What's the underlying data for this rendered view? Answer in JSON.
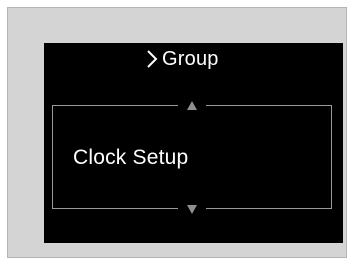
{
  "header": {
    "breadcrumb_text": "Group",
    "breadcrumb_icon": "chevron-right-icon"
  },
  "menu": {
    "current_item": "Clock Setup",
    "scroll_up_icon": "up-arrow-icon",
    "scroll_down_icon": "down-arrow-icon"
  },
  "colors": {
    "screen_background": "#000000",
    "text": "#ffffff",
    "frame_border": "#9a9a9a",
    "arrow": "#8f8f8f",
    "bezel": "#d4d4d4"
  }
}
